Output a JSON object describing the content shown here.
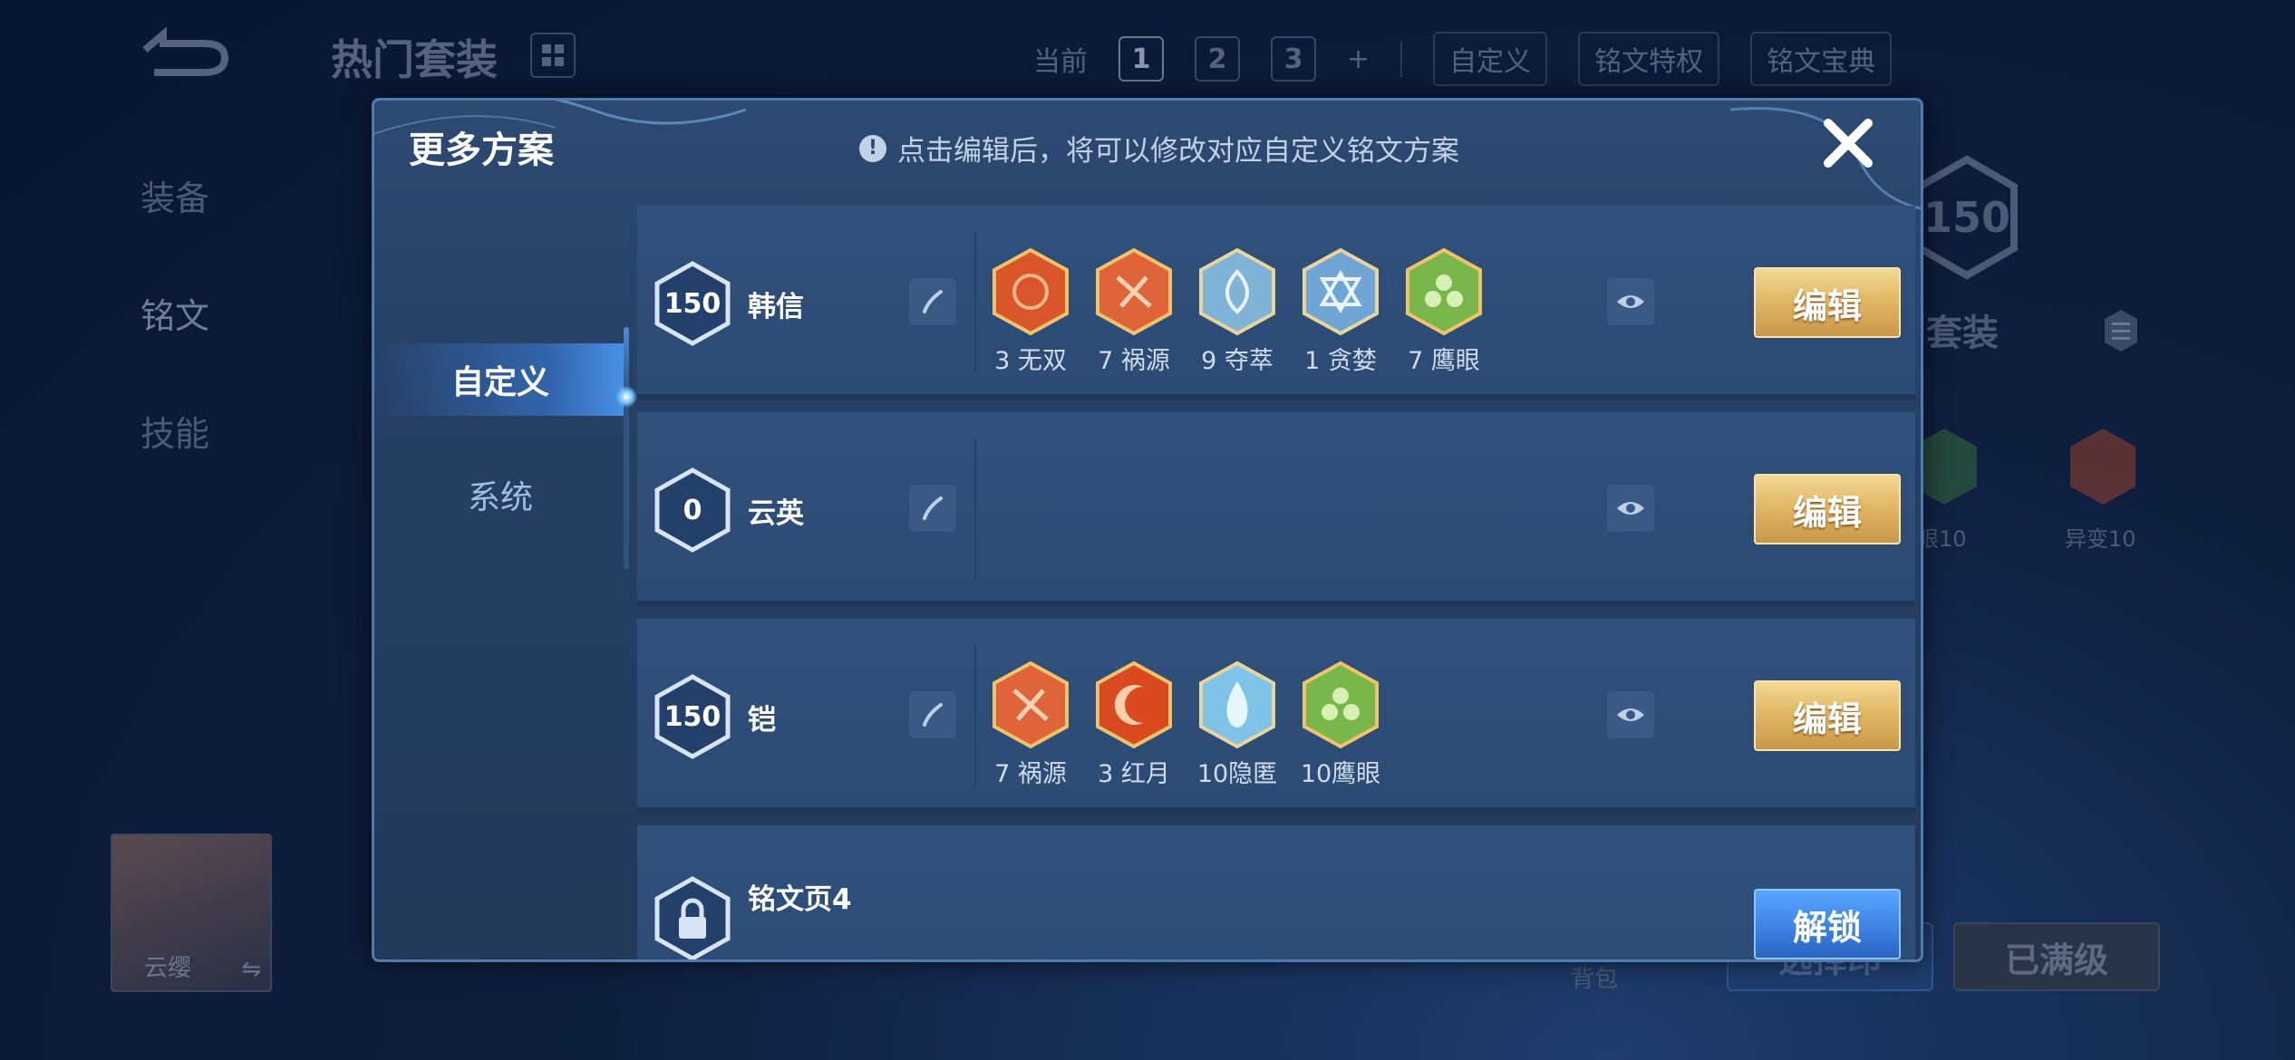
{
  "background": {
    "title": "热门套装",
    "top_tabs": {
      "current_label": "当前",
      "pages": [
        "1",
        "2",
        "3"
      ],
      "add_label": "+",
      "custom_label": "自定义",
      "privilege_label": "铭文特权",
      "codex_label": "铭文宝典"
    },
    "left_menu": [
      "装备",
      "铭文",
      "技能"
    ],
    "right_panel": {
      "level": "150",
      "title": "门套装",
      "rune_labels": [
        "眼10",
        "异变10"
      ]
    },
    "hero_card": {
      "name": "云缨",
      "swap": "⇋"
    },
    "pack_label": "背包",
    "select_button": "选择印",
    "max_level_button": "已满级"
  },
  "modal": {
    "title": "更多方案",
    "hint": "点击编辑后，将可以修改对应自定义铭文方案",
    "close_label": "✕",
    "side_tabs": [
      "自定义",
      "系统"
    ],
    "rows": [
      {
        "level": "150",
        "hero": "韩信",
        "runes": [
          {
            "label": "3 无双",
            "color": "#d9552a"
          },
          {
            "label": "7 祸源",
            "color": "#e0643a"
          },
          {
            "label": "9 夺萃",
            "color": "#7fb3d8"
          },
          {
            "label": "1 贪婪",
            "color": "#6fa6d6"
          },
          {
            "label": "7 鹰眼",
            "color": "#7ab74a"
          }
        ],
        "button": "编辑"
      },
      {
        "level": "0",
        "hero": "云英",
        "runes": [],
        "button": "编辑"
      },
      {
        "level": "150",
        "hero": "铠",
        "runes": [
          {
            "label": "7 祸源",
            "color": "#e0643a"
          },
          {
            "label": "3 红月",
            "color": "#d94a20"
          },
          {
            "label": "10隐匿",
            "color": "#7fc3e8"
          },
          {
            "label": "10鹰眼",
            "color": "#7ab74a"
          }
        ],
        "button": "编辑"
      },
      {
        "level": "",
        "hero": "铭文页4",
        "runes": [],
        "button": "解锁"
      }
    ]
  }
}
